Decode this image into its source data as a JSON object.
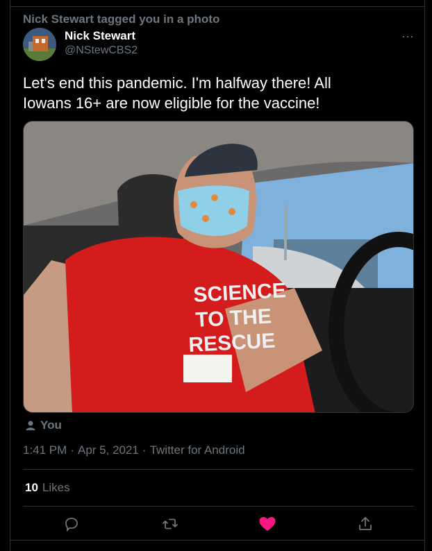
{
  "notification": {
    "text": "Nick Stewart tagged you in a photo"
  },
  "author": {
    "name": "Nick Stewart",
    "handle": "@NStewCBS2"
  },
  "tweet": {
    "text_line1": "Let's end this pandemic. I'm halfway there! All",
    "text_line2": "Iowans 16+ are now eligible for the vaccine!",
    "shirt_text": [
      "SCIENCE",
      "TO THE",
      "RESCUE"
    ]
  },
  "tagged": {
    "label": "You"
  },
  "meta": {
    "time": "1:41 PM",
    "sep": "·",
    "date": "Apr 5, 2021",
    "source": "Twitter for Android"
  },
  "stats": {
    "likes_count": "10",
    "likes_label": "Likes"
  },
  "actions": [
    "reply-icon",
    "retweet-icon",
    "like-icon",
    "share-icon"
  ],
  "colors": {
    "background": "#000000",
    "muted": "#6e767d",
    "like": "#f91880",
    "divider": "#2f3336"
  }
}
